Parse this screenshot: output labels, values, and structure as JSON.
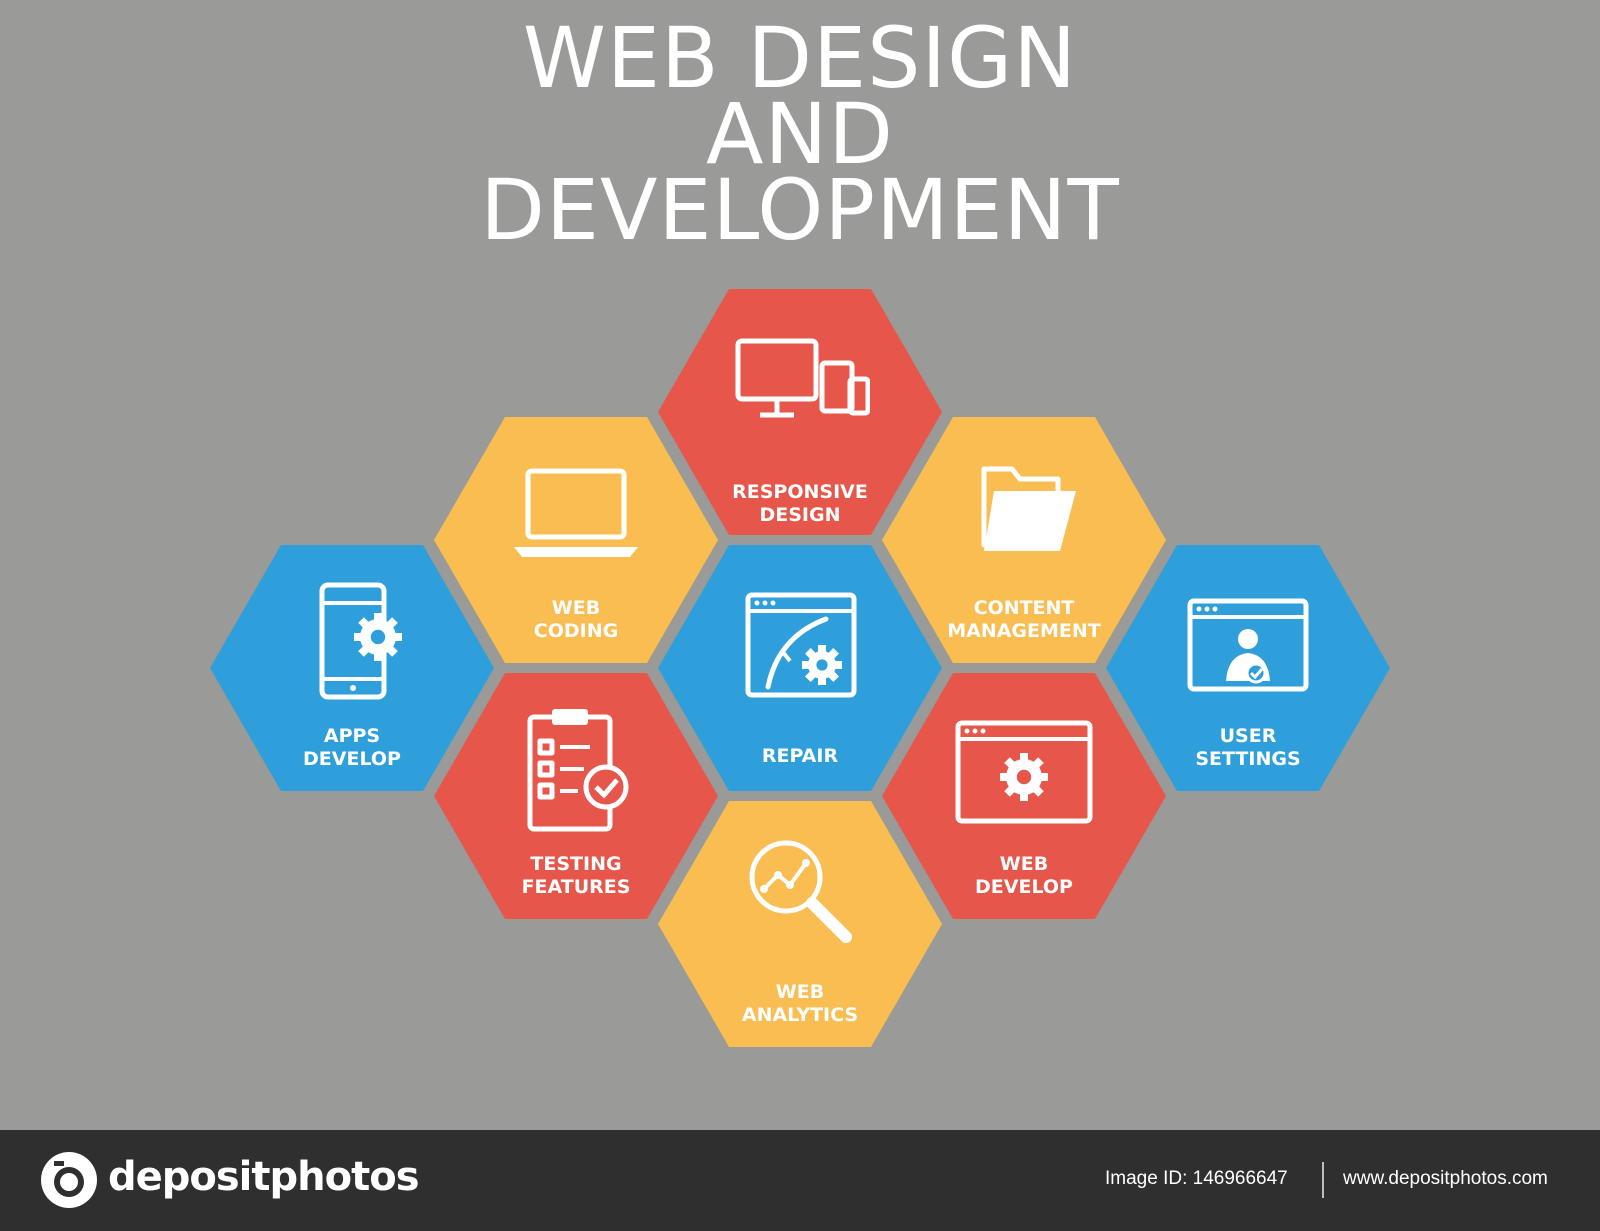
{
  "title": {
    "line1": "WEB DESIGN",
    "line2": "AND",
    "line3": "DEVELOPMENT"
  },
  "colors": {
    "background": "#9a9a98",
    "red": "#e6564a",
    "yellow": "#f9bd52",
    "blue": "#2e9fdb",
    "footer": "#2f2f2f"
  },
  "hexes": [
    {
      "id": "responsive-design",
      "label_lines": [
        "RESPONSIVE",
        "DESIGN"
      ],
      "color": "#e6564a",
      "icon": "devices-icon"
    },
    {
      "id": "web-coding",
      "label_lines": [
        "WEB",
        "CODING"
      ],
      "color": "#f9bd52",
      "icon": "laptop-code-icon",
      "icon_text": "</>"
    },
    {
      "id": "content-management",
      "label_lines": [
        "CONTENT",
        "MANAGEMENT"
      ],
      "color": "#f9bd52",
      "icon": "folder-icon"
    },
    {
      "id": "apps-develop",
      "label_lines": [
        "APPS",
        "DEVELOP"
      ],
      "color": "#2e9fdb",
      "icon": "mobile-gear-icon"
    },
    {
      "id": "repair",
      "label_lines": [
        "REPAIR"
      ],
      "color": "#2e9fdb",
      "icon": "browser-repair-icon"
    },
    {
      "id": "user-settings",
      "label_lines": [
        "USER",
        "SETTINGS"
      ],
      "color": "#2e9fdb",
      "icon": "browser-user-icon"
    },
    {
      "id": "testing-features",
      "label_lines": [
        "TESTING",
        "FEATURES"
      ],
      "color": "#e6564a",
      "icon": "clipboard-check-icon"
    },
    {
      "id": "web-develop",
      "label_lines": [
        "WEB",
        "DEVELOP"
      ],
      "color": "#e6564a",
      "icon": "browser-gear-icon"
    },
    {
      "id": "web-analytics",
      "label_lines": [
        "WEB",
        "ANALYTICS"
      ],
      "color": "#f9bd52",
      "icon": "magnifier-chart-icon"
    }
  ],
  "watermark": "depositphotos",
  "footer": {
    "brand": "depositphotos",
    "image_id": "Image ID: 146966647",
    "url": "www.depositphotos.com"
  }
}
